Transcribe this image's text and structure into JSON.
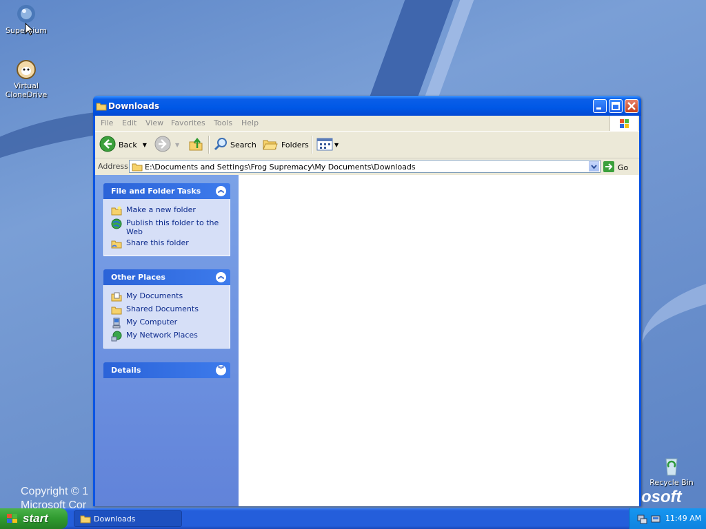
{
  "desktop": {
    "icons": [
      {
        "label": "Superbium"
      },
      {
        "label": "Virtual CloneDrive"
      },
      {
        "label": "Recycle Bin"
      }
    ],
    "copyright_line1": "Copyright © 1",
    "copyright_line2": "Microsoft Cor",
    "brand": "osoft"
  },
  "window": {
    "title": "Downloads",
    "menu": [
      "File",
      "Edit",
      "View",
      "Favorites",
      "Tools",
      "Help"
    ],
    "toolbar": {
      "back": "Back",
      "search": "Search",
      "folders": "Folders"
    },
    "address": {
      "label": "Address",
      "path": "E:\\Documents and Settings\\Frog Supremacy\\My Documents\\Downloads",
      "go": "Go"
    },
    "panels": {
      "file_folder_tasks": {
        "title": "File and Folder Tasks",
        "items": [
          "Make a new folder",
          "Publish this folder to the Web",
          "Share this folder"
        ]
      },
      "other_places": {
        "title": "Other Places",
        "items": [
          "My Documents",
          "Shared Documents",
          "My Computer",
          "My Network Places"
        ]
      },
      "details": {
        "title": "Details"
      }
    }
  },
  "taskbar": {
    "start": "start",
    "task": "Downloads",
    "clock": "11:49 AM"
  },
  "colors": {
    "titlebar": "#0058e6",
    "taskpane": "#6f95e0",
    "start": "#2f9a2f",
    "taskbar": "#245edb"
  }
}
